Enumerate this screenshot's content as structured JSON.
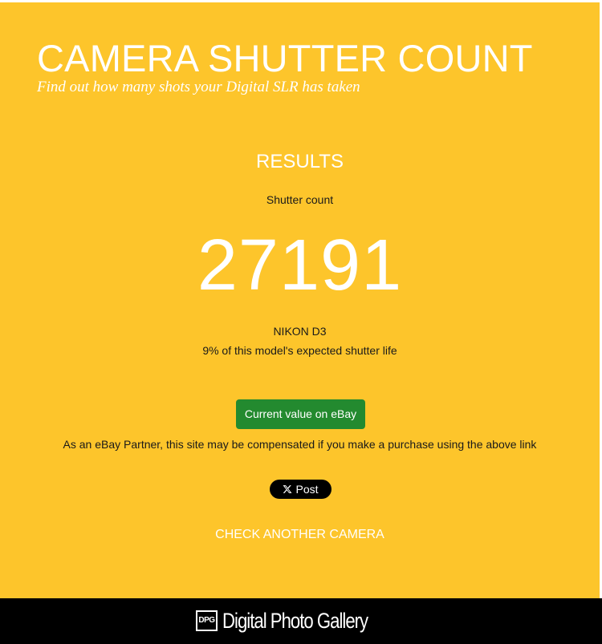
{
  "header": {
    "title": "CAMERA SHUTTER COUNT",
    "tagline": "Find out how many shots your Digital SLR has taken"
  },
  "results": {
    "heading": "RESULTS",
    "count_label": "Shutter count",
    "count_value": "27191",
    "model": "NIKON D3",
    "shutter_life_text": "9% of this model's expected shutter life"
  },
  "actions": {
    "ebay_button_label": "Current value on eBay",
    "disclaimer": "As an eBay Partner, this site may be compensated if you make a purchase using the above link",
    "post_button_label": "Post",
    "check_another_label": "CHECK ANOTHER CAMERA"
  },
  "footer": {
    "logo_text": "DPG",
    "brand_name": "Digital Photo Gallery"
  },
  "colors": {
    "background": "#fdc52b",
    "button_green": "#238a2f",
    "footer": "#000000",
    "text_light": "#ffffff"
  },
  "icons": {
    "post_button": "x-logo-icon",
    "footer_logo": "dpg-logo-icon"
  }
}
